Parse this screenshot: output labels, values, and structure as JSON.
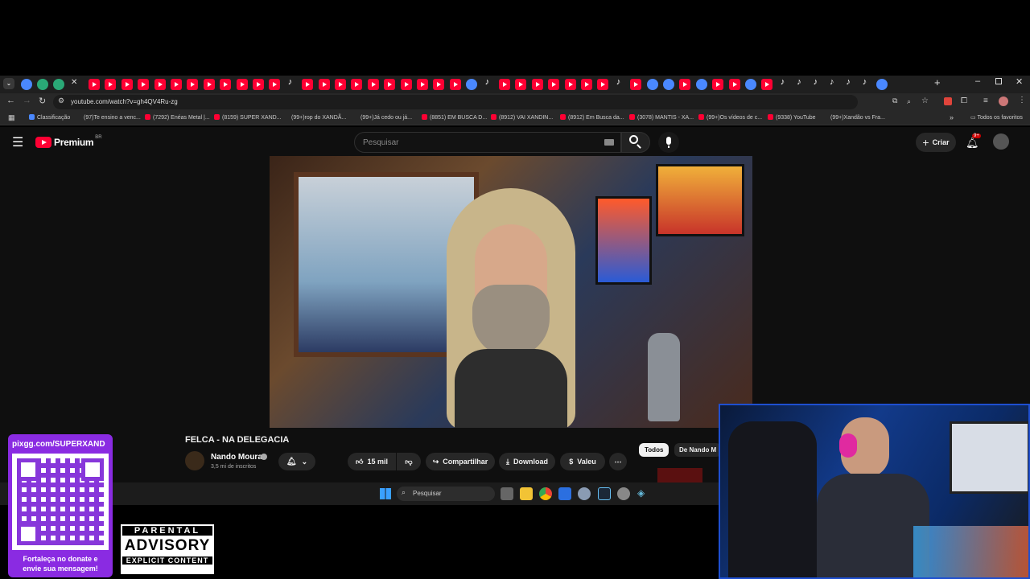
{
  "browser": {
    "url": "youtube.com/watch?v=gh4QV4Ru-zg",
    "bookmarks": [
      "Classificação",
      "(97)Te ensino a venc...",
      "(7292) Enéas Metal |...",
      "(8159) SUPER XAND...",
      "(99+)rop do XANDÃ...",
      "(99+)Já cedo ou já...",
      "(8851) EM BUSCA D...",
      "(8912) VAI XANDIN...",
      "(8912) Em Busca da...",
      "(3078) MANTIS - XA...",
      "(99+)Os vídeos de c...",
      "(9338) YouTube",
      "(99+)Xandão vs Fra..."
    ],
    "all_bookmarks_label": "Todos os favoritos"
  },
  "youtube": {
    "logo_label": "Premium",
    "logo_region": "BR",
    "search_placeholder": "Pesquisar",
    "create_label": "Criar",
    "notifications_badge": "9+",
    "video_title": "FELCA - NA DELEGACIA",
    "channel_name": "Nando Moura",
    "subscribers": "3,5 mi de inscritos",
    "likes": "15 mil",
    "share_label": "Compartilhar",
    "download_label": "Download",
    "thanks_label": "Valeu",
    "chip_all": "Todos",
    "chip_channel": "De Nando M"
  },
  "taskbar": {
    "search_placeholder": "Pesquisar"
  },
  "overlay": {
    "qr_url": "pixgg.com/SUPERXAND",
    "qr_caption": "Fortaleça no donate e envie sua mensagem!",
    "advisory_top": "PARENTAL",
    "advisory_mid": "ADVISORY",
    "advisory_bottom": "EXPLICIT CONTENT"
  },
  "colors": {
    "youtube_red": "#ff0033",
    "qr_purple": "#8a2be2",
    "webcam_border": "#1e4fd0"
  }
}
